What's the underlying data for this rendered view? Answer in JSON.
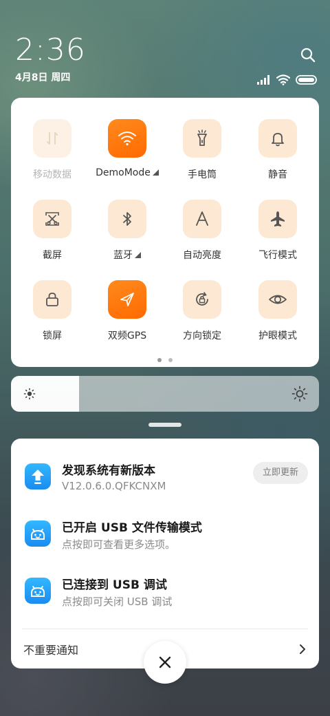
{
  "status_bar": {
    "time": "2:36",
    "date": "4月8日 周四"
  },
  "icons": {
    "search": "search-icon",
    "signal": "signal-icon",
    "wifi": "wifi-icon",
    "battery": "battery-icon"
  },
  "quick_settings": {
    "tiles": [
      {
        "label": "移动数据",
        "icon": "mobile-data-icon",
        "state": "disabled"
      },
      {
        "label": "DemoMode",
        "icon": "wifi-icon",
        "state": "active",
        "has_caret": true
      },
      {
        "label": "手电筒",
        "icon": "flashlight-icon",
        "state": "off"
      },
      {
        "label": "静音",
        "icon": "bell-icon",
        "state": "off"
      },
      {
        "label": "截屏",
        "icon": "screenshot-icon",
        "state": "off"
      },
      {
        "label": "蓝牙",
        "icon": "bluetooth-icon",
        "state": "off",
        "has_caret": true
      },
      {
        "label": "自动亮度",
        "icon": "auto-brightness-icon",
        "state": "off"
      },
      {
        "label": "飞行模式",
        "icon": "airplane-icon",
        "state": "off"
      },
      {
        "label": "锁屏",
        "icon": "lock-icon",
        "state": "off"
      },
      {
        "label": "双频GPS",
        "icon": "gps-icon",
        "state": "active"
      },
      {
        "label": "方向锁定",
        "icon": "rotation-lock-icon",
        "state": "off"
      },
      {
        "label": "护眼模式",
        "icon": "eye-icon",
        "state": "off"
      }
    ],
    "pages": 2,
    "current_page": 1
  },
  "brightness": {
    "level": 0.22
  },
  "notifications": [
    {
      "title": "发现系统有新版本",
      "subtitle": "V12.0.6.0.QFKCNXM",
      "action": "立即更新",
      "icon": "update-arrow-icon"
    },
    {
      "title": "已开启 USB 文件传输模式",
      "subtitle": "点按即可查看更多选项。",
      "icon": "android-icon"
    },
    {
      "title": "已连接到 USB 调试",
      "subtitle": "点按即可关闭 USB 调试",
      "icon": "android-icon"
    }
  ],
  "footer": {
    "unimportant_label": "不重要通知"
  },
  "colors": {
    "accent": "#ff7a0f",
    "tile_off": "#fde8d3",
    "notif_icon": "#1a8cf0"
  }
}
